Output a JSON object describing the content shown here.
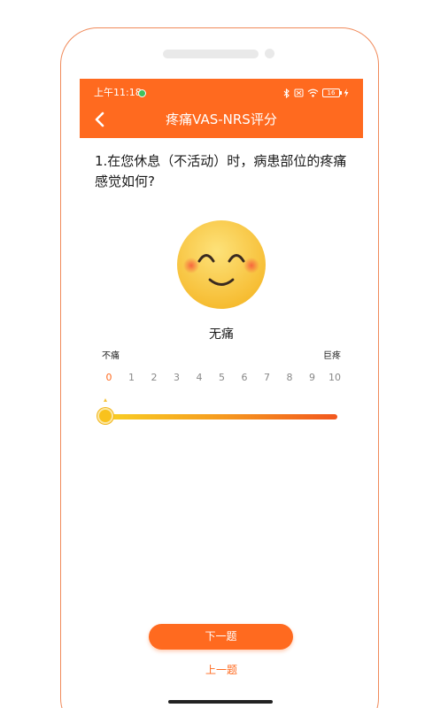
{
  "status_bar": {
    "time": "上午11:18",
    "battery_level": "16"
  },
  "header": {
    "title": "疼痛VAS-NRS评分"
  },
  "question": {
    "text": "1.在您休息（不活动）时，病患部位的疼痛感觉如何?"
  },
  "face": {
    "icon": "smiling-face-icon",
    "label": "无痛"
  },
  "scale": {
    "min_label": "不痛",
    "max_label": "巨疼",
    "ticks": [
      "0",
      "1",
      "2",
      "3",
      "4",
      "5",
      "6",
      "7",
      "8",
      "9",
      "10"
    ],
    "selected_value": 0
  },
  "buttons": {
    "next_label": "下一题",
    "prev_label": "上一题"
  },
  "colors": {
    "accent": "#ff6a1f",
    "slider_start": "#f8cf24",
    "slider_end": "#f2571e",
    "face": "#f9c63a"
  }
}
